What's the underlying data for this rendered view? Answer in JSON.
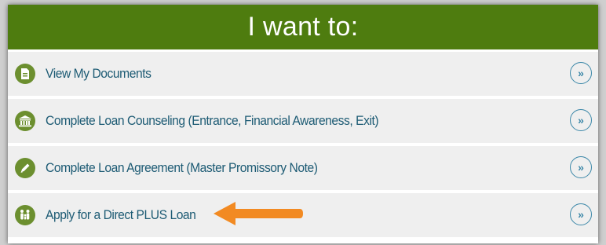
{
  "header": {
    "title": "I want to:"
  },
  "items": [
    {
      "label": "View My Documents",
      "icon": "document-icon"
    },
    {
      "label": "Complete Loan Counseling (Entrance, Financial Awareness, Exit)",
      "icon": "bank-icon"
    },
    {
      "label": "Complete Loan Agreement (Master Promissory Note)",
      "icon": "pencil-icon"
    },
    {
      "label": "Apply for a Direct PLUS Loan",
      "icon": "family-icon"
    }
  ],
  "go_button_text": "»",
  "colors": {
    "header_bg": "#4e7c0f",
    "row_bg": "#efefef",
    "link_text": "#1d5b74",
    "icon_bg": "#6c8f2f",
    "go_circle": "#3b87a8",
    "highlight_arrow": "#f28a22"
  }
}
